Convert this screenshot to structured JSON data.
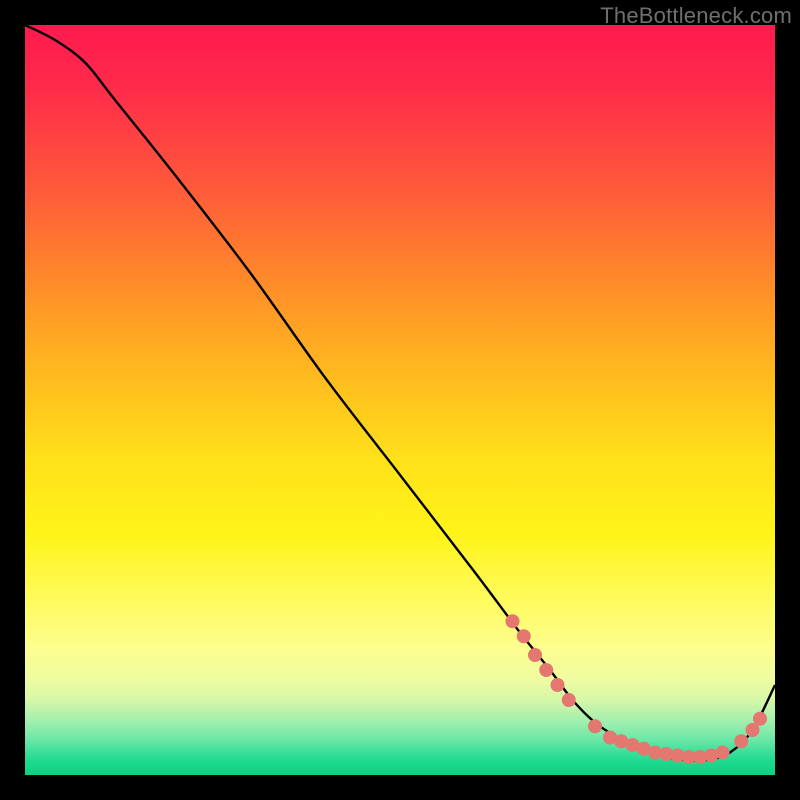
{
  "watermark": {
    "text": "TheBottleneck.com"
  },
  "colors": {
    "gradient_top": "#ff1a4f",
    "gradient_mid": "#ffe11a",
    "gradient_bottom": "#0fd183",
    "curve": "#000000",
    "marker": "#e4776f"
  },
  "chart_data": {
    "type": "line",
    "title": "",
    "xlabel": "",
    "ylabel": "",
    "xlim": [
      0,
      100
    ],
    "ylim": [
      0,
      100
    ],
    "series": [
      {
        "name": "curve",
        "x": [
          0,
          4,
          8,
          12,
          20,
          30,
          40,
          50,
          60,
          66,
          70,
          73,
          76,
          79,
          82,
          85,
          88,
          91,
          94,
          97,
          100
        ],
        "y": [
          100,
          98,
          95,
          90,
          80,
          67,
          53,
          40,
          27,
          19,
          14,
          10,
          7,
          5,
          3.5,
          2.5,
          2,
          2,
          3,
          6,
          12
        ]
      }
    ],
    "markers": [
      {
        "name": "left-cluster-1",
        "x": 65.0,
        "y": 20.5
      },
      {
        "name": "left-cluster-2",
        "x": 66.5,
        "y": 18.5
      },
      {
        "name": "left-cluster-3",
        "x": 68.0,
        "y": 16.0
      },
      {
        "name": "left-cluster-4",
        "x": 69.5,
        "y": 14.0
      },
      {
        "name": "left-cluster-5",
        "x": 71.0,
        "y": 12.0
      },
      {
        "name": "left-cluster-6",
        "x": 72.5,
        "y": 10.0
      },
      {
        "name": "bottom-1",
        "x": 76.0,
        "y": 6.5
      },
      {
        "name": "bottom-2",
        "x": 78.0,
        "y": 5.0
      },
      {
        "name": "bottom-3",
        "x": 79.5,
        "y": 4.5
      },
      {
        "name": "bottom-4",
        "x": 81.0,
        "y": 4.0
      },
      {
        "name": "bottom-5",
        "x": 82.5,
        "y": 3.5
      },
      {
        "name": "bottom-6",
        "x": 84.0,
        "y": 3.0
      },
      {
        "name": "bottom-7",
        "x": 85.5,
        "y": 2.8
      },
      {
        "name": "bottom-8",
        "x": 87.0,
        "y": 2.6
      },
      {
        "name": "bottom-9",
        "x": 88.5,
        "y": 2.4
      },
      {
        "name": "bottom-10",
        "x": 90.0,
        "y": 2.4
      },
      {
        "name": "bottom-11",
        "x": 91.5,
        "y": 2.6
      },
      {
        "name": "bottom-12",
        "x": 93.0,
        "y": 3.0
      },
      {
        "name": "right-cluster-1",
        "x": 95.5,
        "y": 4.5
      },
      {
        "name": "right-cluster-2",
        "x": 97.0,
        "y": 6.0
      },
      {
        "name": "right-cluster-3",
        "x": 98.0,
        "y": 7.5
      }
    ]
  }
}
